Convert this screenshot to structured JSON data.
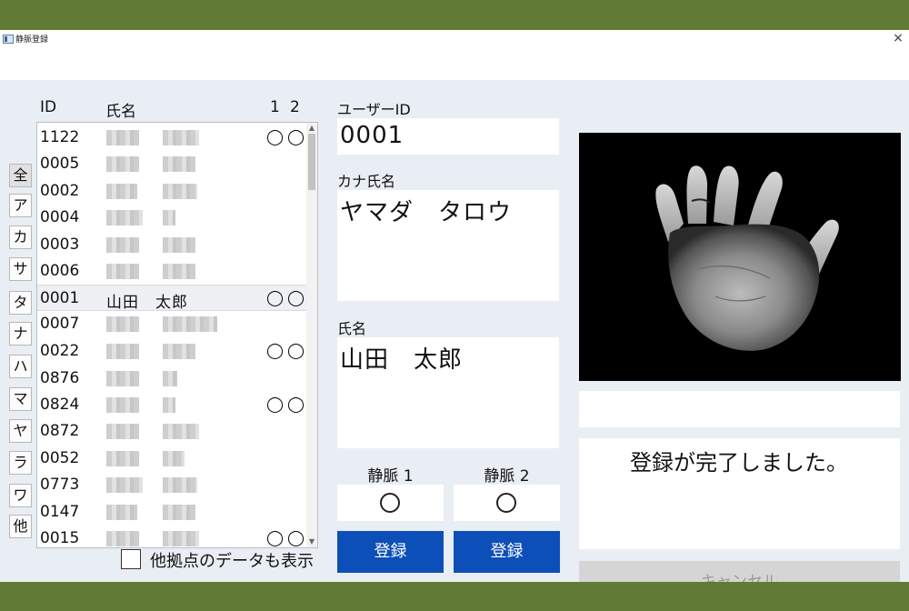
{
  "window": {
    "title": "静脈登録",
    "close_label": "×"
  },
  "list": {
    "headers": {
      "id": "ID",
      "name": "氏名",
      "vein1": "1",
      "vein2": "2"
    },
    "rows": [
      {
        "id": "1122",
        "name": "",
        "v1": "◯",
        "v2": "◯",
        "blurred": true
      },
      {
        "id": "0005",
        "name": "",
        "v1": "",
        "v2": "",
        "blurred": true
      },
      {
        "id": "0002",
        "name": "",
        "v1": "",
        "v2": "",
        "blurred": true
      },
      {
        "id": "0004",
        "name": "",
        "v1": "",
        "v2": "",
        "blurred": true
      },
      {
        "id": "0003",
        "name": "",
        "v1": "",
        "v2": "",
        "blurred": true
      },
      {
        "id": "0006",
        "name": "",
        "v1": "",
        "v2": "",
        "blurred": true
      },
      {
        "id": "0001",
        "name": "山田　太郎",
        "v1": "◯",
        "v2": "◯",
        "blurred": false,
        "selected": true
      },
      {
        "id": "0007",
        "name": "",
        "v1": "",
        "v2": "",
        "blurred": true
      },
      {
        "id": "0022",
        "name": "",
        "v1": "◯",
        "v2": "◯",
        "blurred": true
      },
      {
        "id": "0876",
        "name": "",
        "v1": "",
        "v2": "",
        "blurred": true
      },
      {
        "id": "0824",
        "name": "",
        "v1": "◯",
        "v2": "◯",
        "blurred": true
      },
      {
        "id": "0872",
        "name": "",
        "v1": "",
        "v2": "",
        "blurred": true
      },
      {
        "id": "0052",
        "name": "",
        "v1": "",
        "v2": "",
        "blurred": true
      },
      {
        "id": "0773",
        "name": "",
        "v1": "",
        "v2": "",
        "blurred": true
      },
      {
        "id": "0147",
        "name": "",
        "v1": "",
        "v2": "",
        "blurred": true
      },
      {
        "id": "0015",
        "name": "",
        "v1": "◯",
        "v2": "◯",
        "blurred": true
      }
    ]
  },
  "kana_filter": [
    "全",
    "ア",
    "カ",
    "サ",
    "タ",
    "ナ",
    "ハ",
    "マ",
    "ヤ",
    "ラ",
    "ワ",
    "他"
  ],
  "other_sites_checkbox": {
    "label": "他拠点のデータも表示",
    "checked": false
  },
  "form": {
    "user_id_label": "ユーザーID",
    "user_id_value": "0001",
    "kana_name_label": "カナ氏名",
    "kana_name_value": "ヤマダ　タロウ",
    "name_label": "氏名",
    "name_value": "山田　太郎",
    "vein1_label": "静脈 1",
    "vein2_label": "静脈 2",
    "vein1_status": "◯",
    "vein2_status": "◯",
    "register_label": "登録"
  },
  "right": {
    "status_message": "登録が完了しました。",
    "cancel_label": "キャンセル"
  },
  "colors": {
    "register_button": "#0d4fb8",
    "background_band": "#617a35",
    "client_bg": "#e9eef4"
  }
}
